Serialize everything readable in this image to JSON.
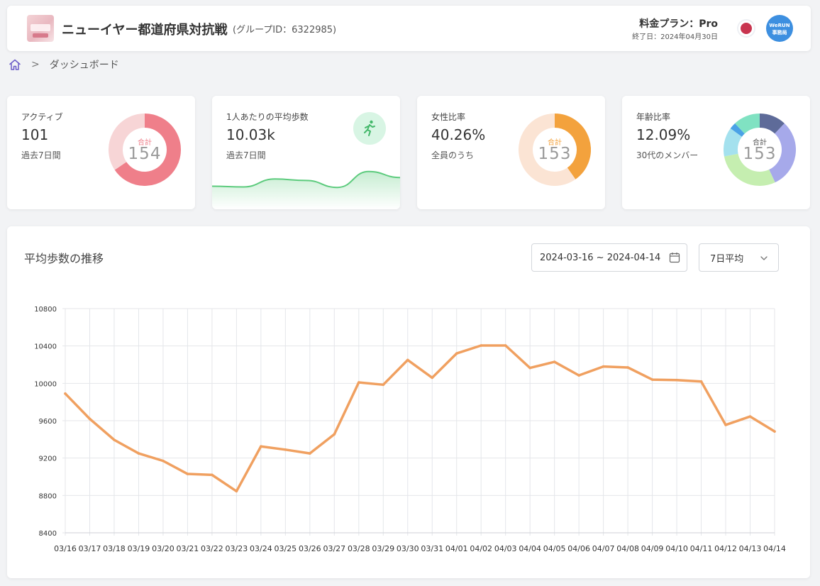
{
  "header": {
    "title": "ニューイヤー都道府県対抗戦",
    "group_id": "(グループID：6322985)",
    "plan": "料金プラン：Pro",
    "plan_end": "終了日：2024年04月30日",
    "avatar_line1": "WeRUN",
    "avatar_line2": "事務局"
  },
  "breadcrumb": {
    "separator": ">",
    "current": "ダッシュボード"
  },
  "cards": {
    "active": {
      "label": "アクティブ",
      "value": "101",
      "note": "過去7日間",
      "total_caption": "合計",
      "total": "154",
      "donut": [
        101,
        53
      ],
      "colors": [
        "#ef7f8a",
        "#f7d5d6"
      ]
    },
    "steps": {
      "label": "1人あたりの平均歩数",
      "value": "10.03k",
      "note": "過去7日間",
      "icon": "running-icon",
      "spark": [
        9.3,
        9.0,
        12.2,
        11.6,
        8.8,
        15.2,
        12.8
      ]
    },
    "female": {
      "label": "女性比率",
      "value": "40.26%",
      "note": "全員のうち",
      "total_caption": "合計",
      "total": "153",
      "donut": [
        40.26,
        59.74
      ],
      "colors": [
        "#f3a23d",
        "#fbe4d4"
      ]
    },
    "age": {
      "label": "年齢比率",
      "value": "12.09%",
      "note": "30代のメンバー",
      "total_caption": "合計",
      "total": "153",
      "donut": [
        12,
        31,
        29,
        13,
        3,
        12
      ],
      "colors": [
        "#5e6b99",
        "#a6a9ea",
        "#c5eeb0",
        "#a4e1ee",
        "#4aa2e6",
        "#80e2c2"
      ]
    }
  },
  "panel": {
    "title": "平均歩数の推移",
    "date_range": "2024-03-16 ~ 2024-04-14",
    "average_select": "7日平均"
  },
  "colors": {
    "line": "#f0a060",
    "accent": "#ef7f8a"
  },
  "chart_data": {
    "type": "line",
    "title": "平均歩数の推移",
    "xlabel": "",
    "ylabel": "",
    "ylim": [
      8400,
      10800
    ],
    "yticks": [
      8400,
      8800,
      9200,
      9600,
      10000,
      10400,
      10800
    ],
    "grid": true,
    "categories": [
      "03/16",
      "03/17",
      "03/18",
      "03/19",
      "03/20",
      "03/21",
      "03/22",
      "03/23",
      "03/24",
      "03/25",
      "03/26",
      "03/27",
      "03/28",
      "03/29",
      "03/30",
      "03/31",
      "04/01",
      "04/02",
      "04/03",
      "04/04",
      "04/05",
      "04/06",
      "04/07",
      "04/08",
      "04/09",
      "04/10",
      "04/11",
      "04/12",
      "04/13",
      "04/14"
    ],
    "series": [
      {
        "values": [
          9890,
          9620,
          9395,
          9250,
          9170,
          9030,
          9020,
          8845,
          9325,
          9290,
          9250,
          9455,
          10010,
          9985,
          10250,
          10060,
          10320,
          10405,
          10405,
          10165,
          10230,
          10085,
          10180,
          10170,
          10040,
          10035,
          10020,
          9555,
          9645,
          9485
        ]
      }
    ]
  }
}
